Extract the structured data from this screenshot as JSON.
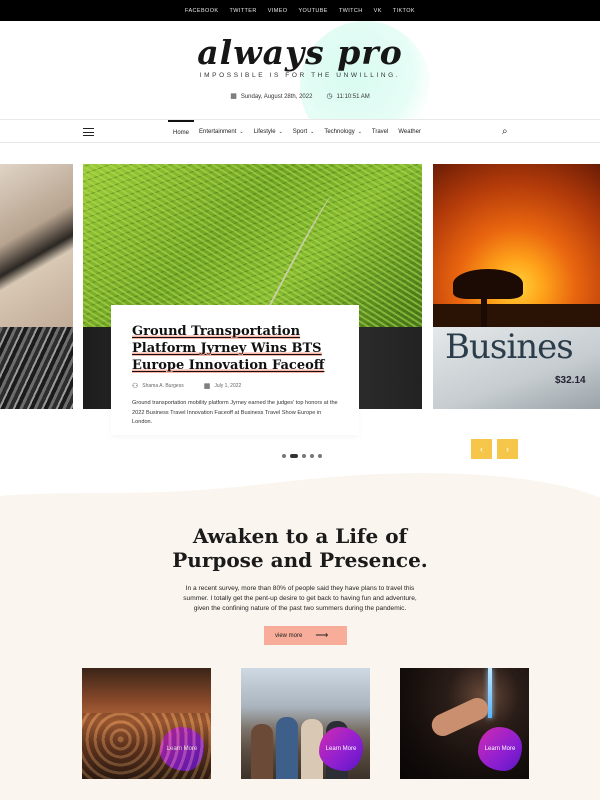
{
  "social": [
    "FACEBOOK",
    "TWITTER",
    "VIMEO",
    "YOUTUBE",
    "TWITCH",
    "VK",
    "TIKTOK"
  ],
  "header": {
    "logo": "always pro",
    "tagline": "IMPOSSIBLE IS FOR THE UNWILLING.",
    "date": "Sunday, August 28th, 2022",
    "time": "11:10:51 AM"
  },
  "nav": {
    "items": [
      {
        "label": "Home",
        "has_dropdown": false,
        "active": true
      },
      {
        "label": "Entertainment",
        "has_dropdown": true
      },
      {
        "label": "Lifestyle",
        "has_dropdown": true
      },
      {
        "label": "Sport",
        "has_dropdown": true
      },
      {
        "label": "Technology",
        "has_dropdown": true
      },
      {
        "label": "Travel",
        "has_dropdown": false
      },
      {
        "label": "Weather",
        "has_dropdown": false
      }
    ]
  },
  "slider": {
    "featured": {
      "title": "Ground Transportation Platform Jyrney Wins BTS Europe Innovation Faceoff",
      "author": "Shama A. Burgess",
      "date": "July 1, 2022",
      "excerpt": "Ground transportation mobility platform Jyrney earned the judges' top honors at the 2022 Business Travel Innovation Faceoff at Business Travel Show Europe in London."
    },
    "newspaper_word": "Busines",
    "newspaper_price": "$32.14",
    "prev_icon": "chevron-left",
    "next_icon": "chevron-right",
    "dots": 5,
    "active_dot": 1
  },
  "promo": {
    "title_line1": "Awaken to a Life of",
    "title_line2": "Purpose and Presence.",
    "text": "In a recent survey, more than 80% of people said they have plans to travel this summer. I totally get the pent-up desire to get back to having fun and adventure, given the confining nature of the past two summers during the pandemic.",
    "button": "view more"
  },
  "tiles": [
    {
      "button": "Learn More"
    },
    {
      "button": "Learn More"
    },
    {
      "button": "Learn More"
    }
  ],
  "colors": {
    "accent_yellow": "#f6c64a",
    "accent_salmon": "#f7ad99",
    "learn_gradient_start": "#d12bb0",
    "learn_gradient_end": "#5a16c6",
    "cream_background": "#fbf5ef"
  }
}
